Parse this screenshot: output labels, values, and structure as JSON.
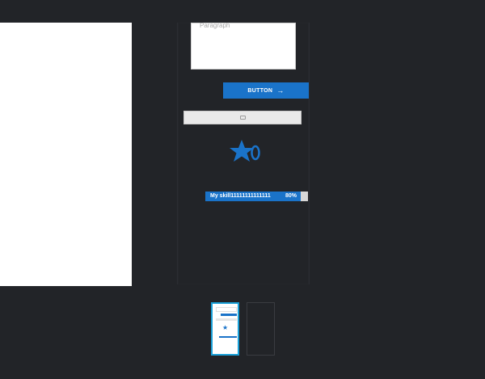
{
  "paragraph": {
    "placeholder": "Paragraph"
  },
  "button": {
    "label": "BUTTON",
    "arrow_icon": "arrow-right-icon"
  },
  "gray_button": {
    "icon": "image-placeholder-icon"
  },
  "star_widget": {
    "icon": "star-icon",
    "color": "#1a73c9"
  },
  "skill": {
    "label": "My skill11111111111111",
    "percent_text": "80%",
    "value": 0.8,
    "color": "#1a73c9"
  },
  "pages": [
    {
      "active": true
    },
    {
      "active": false
    }
  ],
  "colors": {
    "accent": "#1a73c9",
    "background": "#222428",
    "thumb_active_border": "#1aa0d8"
  }
}
